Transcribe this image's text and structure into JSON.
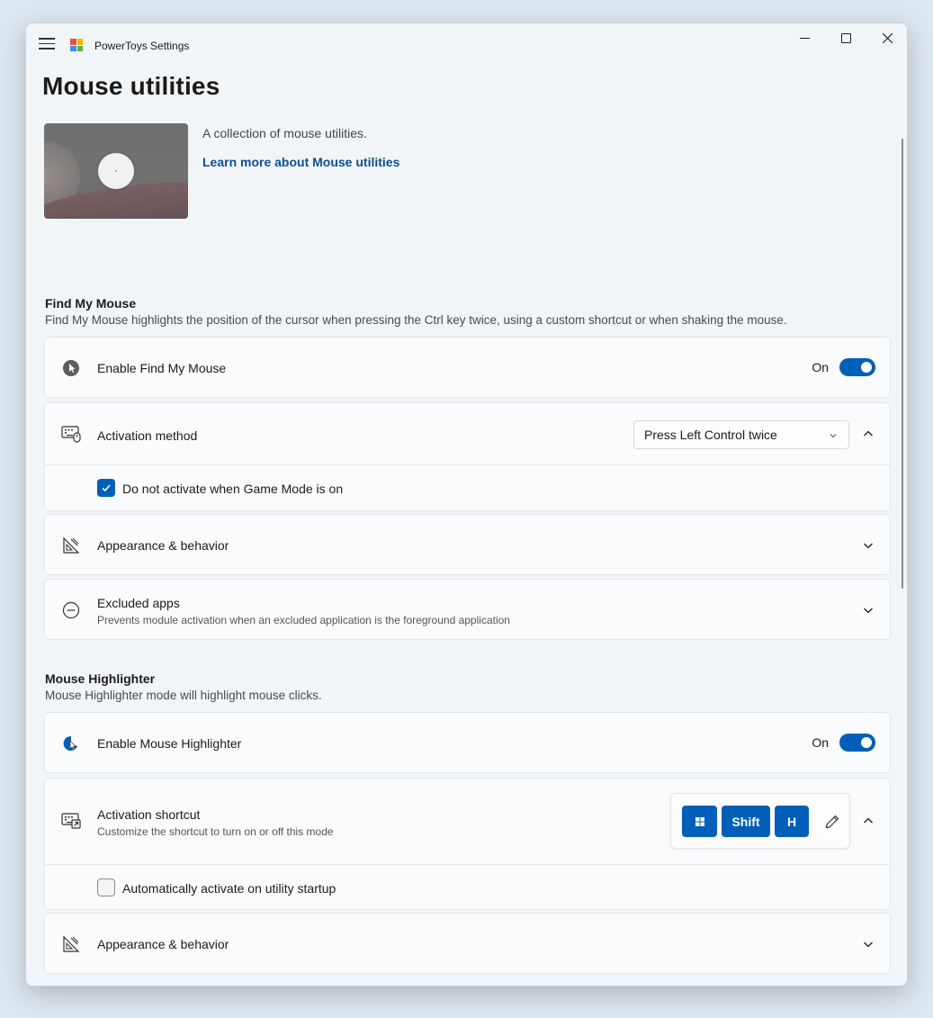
{
  "window": {
    "app_title": "PowerToys Settings"
  },
  "page": {
    "title": "Mouse utilities",
    "hero_description": "A collection of mouse utilities.",
    "hero_link": "Learn more about Mouse utilities"
  },
  "find_my_mouse": {
    "title": "Find My Mouse",
    "description": "Find My Mouse highlights the position of the cursor when pressing the Ctrl key twice, using a custom shortcut or when shaking the mouse.",
    "enable_label": "Enable Find My Mouse",
    "enable_state": "On",
    "activation_label": "Activation method",
    "activation_value": "Press Left Control twice",
    "game_mode_label": "Do not activate when Game Mode is on",
    "game_mode_checked": true,
    "appearance_label": "Appearance & behavior",
    "excluded_label": "Excluded apps",
    "excluded_sublabel": "Prevents module activation when an excluded application is the foreground application"
  },
  "mouse_highlighter": {
    "title": "Mouse Highlighter",
    "description": "Mouse Highlighter mode will highlight mouse clicks.",
    "enable_label": "Enable Mouse Highlighter",
    "enable_state": "On",
    "shortcut_label": "Activation shortcut",
    "shortcut_sublabel": "Customize the shortcut to turn on or off this mode",
    "shortcut_keys": [
      "win",
      "Shift",
      "H"
    ],
    "auto_activate_label": "Automatically activate on utility startup",
    "auto_activate_checked": false,
    "appearance_label": "Appearance & behavior"
  },
  "colors": {
    "accent": "#005fb8",
    "link": "#0a4f96"
  }
}
